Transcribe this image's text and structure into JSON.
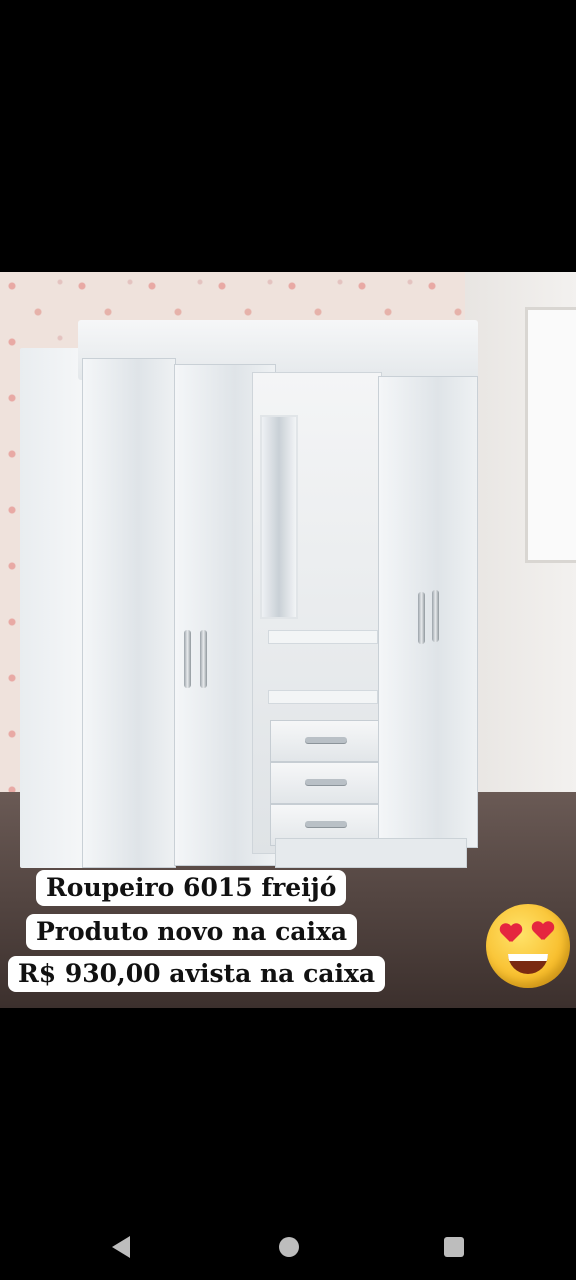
{
  "post": {
    "caption_lines": [
      "Roupeiro 6015 freijó",
      "Produto novo na caixa",
      "R$ 930,00 avista na caixa"
    ],
    "emoji": "heart-eyes-emoji"
  },
  "nav": {
    "icons": [
      "back-icon",
      "home-icon",
      "recents-icon"
    ]
  },
  "colors": {
    "background": "#000000",
    "caption_bg": "#ffffff",
    "caption_text": "#111111"
  }
}
